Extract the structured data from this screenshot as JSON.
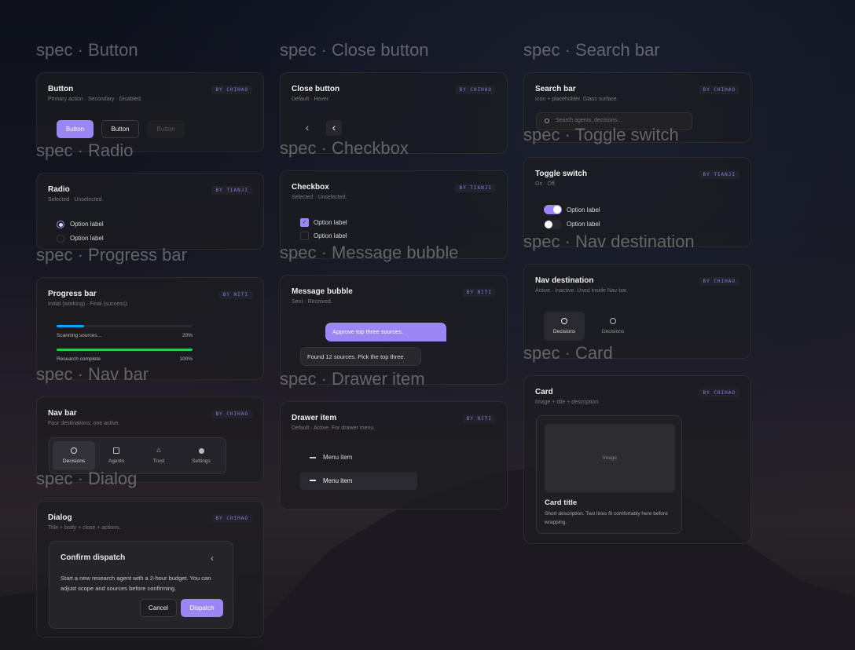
{
  "specs": {
    "button": "spec · Button",
    "radio": "spec · Radio",
    "progress": "spec · Progress bar",
    "navbar": "spec · Nav bar",
    "dialog": "spec · Dialog",
    "close": "spec · Close button",
    "checkbox": "spec · Checkbox",
    "message": "spec · Message bubble",
    "drawer": "spec · Drawer item",
    "search": "spec · Search bar",
    "toggle": "spec · Toggle switch",
    "navdest": "spec · Nav destination",
    "card": "spec · Card"
  },
  "button": {
    "title": "Button",
    "subtitle": "Primary action · Secondary · Disabled.",
    "badge": "BY CHIHAO",
    "primary": "Button",
    "secondary": "Button",
    "disabled": "Button"
  },
  "radio": {
    "title": "Radio",
    "subtitle": "Selected · Unselected.",
    "badge": "BY TIANJI",
    "options": [
      "Option label",
      "Option label"
    ]
  },
  "progress": {
    "title": "Progress bar",
    "subtitle": "Initial (working) · Final (success).",
    "badge": "BY NITI",
    "bars": [
      {
        "label": "Scanning sources…",
        "value_text": "20%",
        "value": 0.2,
        "color": "#0ea5f0"
      },
      {
        "label": "Research complete",
        "value_text": "100%",
        "value": 1.0,
        "color": "#2ec55a"
      }
    ]
  },
  "navbar": {
    "title": "Nav bar",
    "subtitle": "Four destinations; one active.",
    "badge": "BY CHIHAO",
    "items": [
      "Decisions",
      "Agents",
      "Trust",
      "Settings"
    ]
  },
  "dialog": {
    "title": "Dialog",
    "subtitle": "Title + body + close + actions.",
    "badge": "BY CHIHAO",
    "dialog_title": "Confirm dispatch",
    "body": "Start a new research agent with a 2-hour budget. You can adjust scope and sources before confirming.",
    "cancel": "Cancel",
    "confirm": "Dispatch"
  },
  "close": {
    "title": "Close button",
    "subtitle": "Default · Hover.",
    "badge": "BY CHIHAO"
  },
  "checkbox": {
    "title": "Checkbox",
    "subtitle": "Selected · Unselected.",
    "badge": "BY TIANJI",
    "options": [
      "Option label",
      "Option label"
    ]
  },
  "message": {
    "title": "Message bubble",
    "subtitle": "Sent · Received.",
    "badge": "BY NITI",
    "sent": "Approve top three sources.",
    "received": "Found 12 sources. Pick the top three."
  },
  "drawer": {
    "title": "Drawer item",
    "subtitle": "Default · Active. For drawer menu.",
    "badge": "BY NITI",
    "items": [
      "Menu item",
      "Menu item"
    ]
  },
  "search": {
    "title": "Search bar",
    "subtitle": "Icon + placeholder. Glass surface.",
    "badge": "BY CHIHAO",
    "placeholder": "Search agents, decisions…"
  },
  "toggle": {
    "title": "Toggle switch",
    "subtitle": "On · Off.",
    "badge": "BY TIANJI",
    "options": [
      "Option label",
      "Option label"
    ]
  },
  "navdest": {
    "title": "Nav destination",
    "subtitle": "Active · Inactive. Used inside Nav bar.",
    "badge": "BY CHIHAO",
    "items": [
      "Decisions",
      "Decisions"
    ]
  },
  "card": {
    "title": "Card",
    "subtitle": "Image + title + description.",
    "badge": "BY CHIHAO",
    "image": "Image",
    "card_title": "Card title",
    "description": "Short description. Two lines fit comfortably here before wrapping."
  },
  "colors": {
    "accent": "#9a87f5"
  }
}
